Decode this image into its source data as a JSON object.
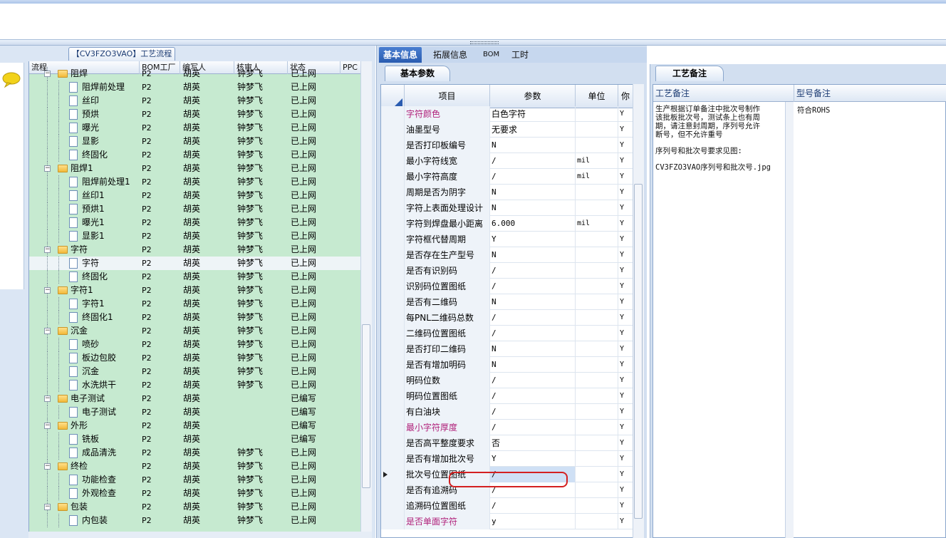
{
  "left_panel": {
    "title": "【CV3FZO3VAO】工艺流程",
    "columns": [
      "流程",
      "BOM工厂",
      "编写人",
      "核审人",
      "状态",
      "PPC"
    ],
    "rows": [
      {
        "level": 0,
        "type": "folder",
        "name": "阻焊",
        "factory": "P2",
        "writer": "胡英",
        "reviewer": "钟梦飞",
        "status": "已上网"
      },
      {
        "level": 1,
        "type": "doc",
        "name": "阻焊前处理",
        "factory": "P2",
        "writer": "胡英",
        "reviewer": "钟梦飞",
        "status": "已上网"
      },
      {
        "level": 1,
        "type": "doc",
        "name": "丝印",
        "factory": "P2",
        "writer": "胡英",
        "reviewer": "钟梦飞",
        "status": "已上网"
      },
      {
        "level": 1,
        "type": "doc",
        "name": "预烘",
        "factory": "P2",
        "writer": "胡英",
        "reviewer": "钟梦飞",
        "status": "已上网"
      },
      {
        "level": 1,
        "type": "doc",
        "name": "曝光",
        "factory": "P2",
        "writer": "胡英",
        "reviewer": "钟梦飞",
        "status": "已上网"
      },
      {
        "level": 1,
        "type": "doc",
        "name": "显影",
        "factory": "P2",
        "writer": "胡英",
        "reviewer": "钟梦飞",
        "status": "已上网"
      },
      {
        "level": 1,
        "type": "doc",
        "name": "终固化",
        "factory": "P2",
        "writer": "胡英",
        "reviewer": "钟梦飞",
        "status": "已上网"
      },
      {
        "level": 0,
        "type": "folder",
        "name": "阻焊1",
        "factory": "P2",
        "writer": "胡英",
        "reviewer": "钟梦飞",
        "status": "已上网"
      },
      {
        "level": 1,
        "type": "doc",
        "name": "阻焊前处理1",
        "factory": "P2",
        "writer": "胡英",
        "reviewer": "钟梦飞",
        "status": "已上网"
      },
      {
        "level": 1,
        "type": "doc",
        "name": "丝印1",
        "factory": "P2",
        "writer": "胡英",
        "reviewer": "钟梦飞",
        "status": "已上网"
      },
      {
        "level": 1,
        "type": "doc",
        "name": "预烘1",
        "factory": "P2",
        "writer": "胡英",
        "reviewer": "钟梦飞",
        "status": "已上网"
      },
      {
        "level": 1,
        "type": "doc",
        "name": "曝光1",
        "factory": "P2",
        "writer": "胡英",
        "reviewer": "钟梦飞",
        "status": "已上网"
      },
      {
        "level": 1,
        "type": "doc",
        "name": "显影1",
        "factory": "P2",
        "writer": "胡英",
        "reviewer": "钟梦飞",
        "status": "已上网"
      },
      {
        "level": 0,
        "type": "folder",
        "name": "字符",
        "factory": "P2",
        "writer": "胡英",
        "reviewer": "钟梦飞",
        "status": "已上网"
      },
      {
        "level": 1,
        "type": "doc",
        "name": "字符",
        "factory": "P2",
        "writer": "胡英",
        "reviewer": "钟梦飞",
        "status": "已上网",
        "selected": true
      },
      {
        "level": 1,
        "type": "doc",
        "name": "终固化",
        "factory": "P2",
        "writer": "胡英",
        "reviewer": "钟梦飞",
        "status": "已上网"
      },
      {
        "level": 0,
        "type": "folder",
        "name": "字符1",
        "factory": "P2",
        "writer": "胡英",
        "reviewer": "钟梦飞",
        "status": "已上网"
      },
      {
        "level": 1,
        "type": "doc",
        "name": "字符1",
        "factory": "P2",
        "writer": "胡英",
        "reviewer": "钟梦飞",
        "status": "已上网"
      },
      {
        "level": 1,
        "type": "doc",
        "name": "终固化1",
        "factory": "P2",
        "writer": "胡英",
        "reviewer": "钟梦飞",
        "status": "已上网"
      },
      {
        "level": 0,
        "type": "folder",
        "name": "沉金",
        "factory": "P2",
        "writer": "胡英",
        "reviewer": "钟梦飞",
        "status": "已上网"
      },
      {
        "level": 1,
        "type": "doc",
        "name": "喷砂",
        "factory": "P2",
        "writer": "胡英",
        "reviewer": "钟梦飞",
        "status": "已上网"
      },
      {
        "level": 1,
        "type": "doc",
        "name": "板边包胶",
        "factory": "P2",
        "writer": "胡英",
        "reviewer": "钟梦飞",
        "status": "已上网"
      },
      {
        "level": 1,
        "type": "doc",
        "name": "沉金",
        "factory": "P2",
        "writer": "胡英",
        "reviewer": "钟梦飞",
        "status": "已上网"
      },
      {
        "level": 1,
        "type": "doc",
        "name": "水洗烘干",
        "factory": "P2",
        "writer": "胡英",
        "reviewer": "钟梦飞",
        "status": "已上网"
      },
      {
        "level": 0,
        "type": "folder",
        "name": "电子测试",
        "factory": "P2",
        "writer": "胡英",
        "reviewer": "",
        "status": "已编写"
      },
      {
        "level": 1,
        "type": "doc",
        "name": "电子测试",
        "factory": "P2",
        "writer": "胡英",
        "reviewer": "",
        "status": "已编写"
      },
      {
        "level": 0,
        "type": "folder",
        "name": "外形",
        "factory": "P2",
        "writer": "胡英",
        "reviewer": "",
        "status": "已编写"
      },
      {
        "level": 1,
        "type": "doc",
        "name": "铣板",
        "factory": "P2",
        "writer": "胡英",
        "reviewer": "",
        "status": "已编写"
      },
      {
        "level": 1,
        "type": "doc",
        "name": "成品清洗",
        "factory": "P2",
        "writer": "胡英",
        "reviewer": "钟梦飞",
        "status": "已上网"
      },
      {
        "level": 0,
        "type": "folder",
        "name": "终检",
        "factory": "P2",
        "writer": "胡英",
        "reviewer": "钟梦飞",
        "status": "已上网"
      },
      {
        "level": 1,
        "type": "doc",
        "name": "功能检查",
        "factory": "P2",
        "writer": "胡英",
        "reviewer": "钟梦飞",
        "status": "已上网"
      },
      {
        "level": 1,
        "type": "doc",
        "name": "外观检查",
        "factory": "P2",
        "writer": "胡英",
        "reviewer": "钟梦飞",
        "status": "已上网"
      },
      {
        "level": 0,
        "type": "folder",
        "name": "包装",
        "factory": "P2",
        "writer": "胡英",
        "reviewer": "钟梦飞",
        "status": "已上网"
      },
      {
        "level": 1,
        "type": "doc",
        "name": "内包装",
        "factory": "P2",
        "writer": "胡英",
        "reviewer": "钟梦飞",
        "status": "已上网"
      }
    ]
  },
  "middle_panel": {
    "tabs": [
      "基本信息",
      "拓展信息",
      "BOM",
      "工时"
    ],
    "active_tab": "基本信息",
    "subtab": "基本参数",
    "columns": [
      "项目",
      "参数",
      "单位",
      "你"
    ],
    "rows": [
      {
        "name": "字符颜色",
        "value": "白色字符",
        "unit": "",
        "flag": "Y",
        "highlight": true
      },
      {
        "name": "油墨型号",
        "value": "无要求",
        "unit": "",
        "flag": "Y"
      },
      {
        "name": "是否打印板编号",
        "value": "N",
        "unit": "",
        "flag": "Y"
      },
      {
        "name": "最小字符线宽",
        "value": "/",
        "unit": "mil",
        "flag": "Y"
      },
      {
        "name": "最小字符高度",
        "value": "/",
        "unit": "mil",
        "flag": "Y"
      },
      {
        "name": "周期是否为阴字",
        "value": "N",
        "unit": "",
        "flag": "Y"
      },
      {
        "name": "字符上表面处理设计",
        "value": "N",
        "unit": "",
        "flag": "Y"
      },
      {
        "name": "字符到焊盘最小距离",
        "value": "6.000",
        "unit": "mil",
        "flag": "Y"
      },
      {
        "name": "字符框代替周期",
        "value": "Y",
        "unit": "",
        "flag": "Y"
      },
      {
        "name": "是否存在生产型号",
        "value": "N",
        "unit": "",
        "flag": "Y"
      },
      {
        "name": "是否有识别码",
        "value": "/",
        "unit": "",
        "flag": "Y"
      },
      {
        "name": "识别码位置图纸",
        "value": "/",
        "unit": "",
        "flag": "Y"
      },
      {
        "name": "是否有二维码",
        "value": "N",
        "unit": "",
        "flag": "Y"
      },
      {
        "name": "每PNL二维码总数",
        "value": "/",
        "unit": "",
        "flag": "Y"
      },
      {
        "name": "二维码位置图纸",
        "value": "/",
        "unit": "",
        "flag": "Y"
      },
      {
        "name": "是否打印二维码",
        "value": "N",
        "unit": "",
        "flag": "Y"
      },
      {
        "name": "是否有增加明码",
        "value": "N",
        "unit": "",
        "flag": "Y"
      },
      {
        "name": "明码位数",
        "value": "/",
        "unit": "",
        "flag": "Y"
      },
      {
        "name": "明码位置图纸",
        "value": "/",
        "unit": "",
        "flag": "Y"
      },
      {
        "name": "有白油块",
        "value": "/",
        "unit": "",
        "flag": "Y"
      },
      {
        "name": "最小字符厚度",
        "value": "/",
        "unit": "",
        "flag": "Y",
        "highlight": true
      },
      {
        "name": "是否高平整度要求",
        "value": "否",
        "unit": "",
        "flag": "Y"
      },
      {
        "name": "是否有增加批次号",
        "value": "Y",
        "unit": "",
        "flag": "Y"
      },
      {
        "name": "批次号位置图纸",
        "value": "/",
        "unit": "",
        "flag": "Y",
        "current": true
      },
      {
        "name": "是否有追溯码",
        "value": "/",
        "unit": "",
        "flag": "Y"
      },
      {
        "name": "追溯码位置图纸",
        "value": "/",
        "unit": "",
        "flag": "Y"
      },
      {
        "name": "是否单面字符",
        "value": "y",
        "unit": "",
        "flag": "Y",
        "highlight": true
      }
    ]
  },
  "right_panel": {
    "tab": "工艺备注",
    "columns": [
      "工艺备注",
      "型号备注"
    ],
    "note_lines": [
      "生产根据订单备注中批次号制作",
      "该批板批次号，测试条上也有周",
      "期，请注意封周期，序列号允许",
      "断号，但不允许重号",
      "",
      "序列号和批次号要求见图:",
      "",
      "CV3FZO3VAO序列号和批次号.jpg"
    ],
    "model_note": "符合ROHS"
  },
  "colors": {
    "tree_bg": "#c6ead0",
    "tab_active": "#2a5cb0",
    "highlight_text": "#b0207a",
    "annotation_red": "#d42020"
  }
}
